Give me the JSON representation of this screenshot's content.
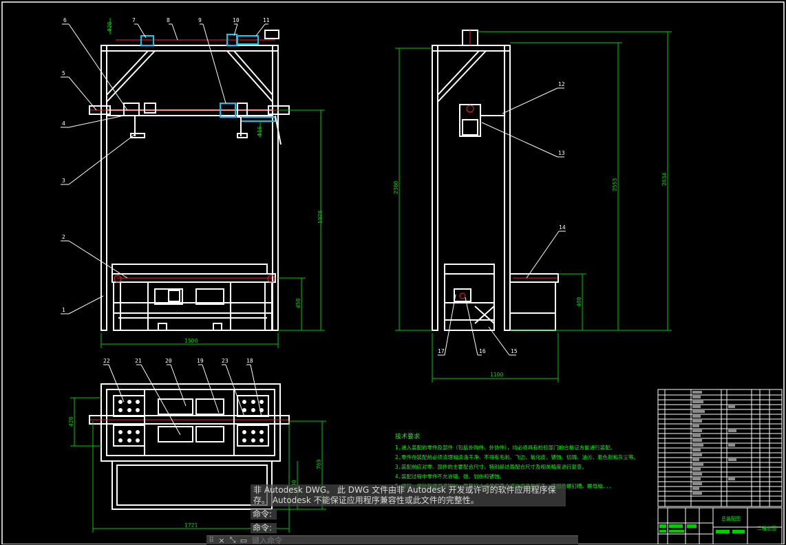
{
  "colors": {
    "background": "#000000",
    "frame": "#ffffff",
    "dimension": "#00cc00",
    "centerline": "#ff2020",
    "part": "#00ccff",
    "leader": "#ffffff",
    "note": "#00ff00"
  },
  "front_view": {
    "balloons": [
      "1",
      "2",
      "3",
      "4",
      "5",
      "6",
      "7",
      "8",
      "9",
      "10",
      "11"
    ],
    "dims": {
      "width": "1500",
      "height_right": "1928",
      "height_low": "450"
    },
    "small_dims": {
      "top_left": "Φ20",
      "right_mid": "Φ16"
    }
  },
  "side_view": {
    "balloons": [
      "12",
      "13",
      "14",
      "15",
      "16",
      "17"
    ],
    "dims": {
      "height_a": "2300",
      "height_b": "2553",
      "height_c": "2634",
      "width": "1100",
      "height_low": "400"
    }
  },
  "top_view": {
    "balloons": [
      "18",
      "19",
      "20",
      "21",
      "22",
      "23"
    ],
    "dims": {
      "width": "1721",
      "depth": "420",
      "depth_right": "769",
      "depth_small": "230"
    }
  },
  "notes": {
    "title": "技术要求",
    "lines": [
      "1.进入装配的零件及部件（包括外购件、外协件），均必须具有检验部门的合格证方能进行装配。",
      "2.零件在装配前必须清理和清洗干净，不得有毛刺、飞边、氧化皮、锈蚀、切屑、油污、着色剂和灰尘等。",
      "3.装配前应对零、部件的主要配合尺寸，特别是过盈配合尺寸及相关精度进行复查。",
      "4.装配过程中零件不允许磕、碰、划伤和锈蚀。",
      "5.螺钉、螺栓和螺母紧固时，严禁打击或使用不合适的旋具和扳手，紧固后螺钉槽、螺母和..."
    ]
  },
  "title_block": {
    "drawing_name": "总装配图",
    "sheet": "二维总图"
  },
  "command": {
    "message": "非 Autodesk DWG。 此 DWG 文件由非 Autodesk 开发或许可的软件应用程序保存。 Autodesk 不能保证应用程序兼容性或此文件的完整性。",
    "history": [
      "命令:",
      "命令:"
    ],
    "placeholder": "键入命令"
  }
}
